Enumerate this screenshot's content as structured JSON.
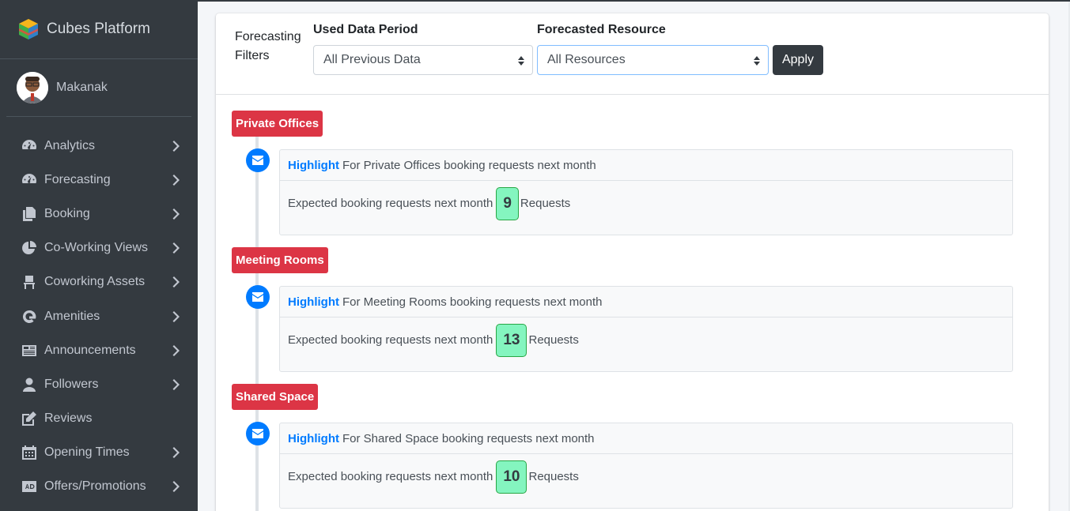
{
  "brand": {
    "name": "Cubes Platform"
  },
  "user": {
    "name": "Makanak"
  },
  "sidebar": {
    "items": [
      {
        "label": "Analytics",
        "icon": "tachometer-icon",
        "has_chevron": true
      },
      {
        "label": "Forecasting",
        "icon": "tachometer-icon",
        "has_chevron": true
      },
      {
        "label": "Booking",
        "icon": "copy-icon",
        "has_chevron": true
      },
      {
        "label": "Co-Working Views",
        "icon": "pie-chart-icon",
        "has_chevron": true
      },
      {
        "label": "Coworking Assets",
        "icon": "chair-icon",
        "has_chevron": true
      },
      {
        "label": "Amenities",
        "icon": "amenities-icon",
        "has_chevron": true
      },
      {
        "label": "Announcements",
        "icon": "newspaper-icon",
        "has_chevron": true
      },
      {
        "label": "Followers",
        "icon": "user-icon",
        "has_chevron": true
      },
      {
        "label": "Reviews",
        "icon": "edit-icon",
        "has_chevron": false
      },
      {
        "label": "Opening Times",
        "icon": "calendar-icon",
        "has_chevron": true
      },
      {
        "label": "Offers/Promotions",
        "icon": "ad-icon",
        "has_chevron": true
      }
    ]
  },
  "filters": {
    "title_line1": "Forecasting",
    "title_line2": "Filters",
    "period_label": "Used Data Period",
    "period_value": "All Previous Data",
    "resource_label": "Forecasted Resource",
    "resource_value": "All Resources",
    "apply_label": "Apply"
  },
  "sections": [
    {
      "label": "Private Offices",
      "highlight": "Highlight",
      "header_text": "For Private Offices booking requests next month",
      "body_prefix": "Expected booking requests next month",
      "value": "9",
      "body_suffix": "Requests"
    },
    {
      "label": "Meeting Rooms",
      "highlight": "Highlight",
      "header_text": "For Meeting Rooms booking requests next month",
      "body_prefix": "Expected booking requests next month",
      "value": "13",
      "body_suffix": "Requests"
    },
    {
      "label": "Shared Space",
      "highlight": "Highlight",
      "header_text": "For Shared Space booking requests next month",
      "body_prefix": "Expected booking requests next month",
      "value": "10",
      "body_suffix": "Requests"
    }
  ],
  "colors": {
    "sidebar_bg": "#343a40",
    "danger": "#dc3545",
    "primary": "#007bff",
    "badge_bg": "#84f5bf",
    "badge_border": "#28a745"
  }
}
